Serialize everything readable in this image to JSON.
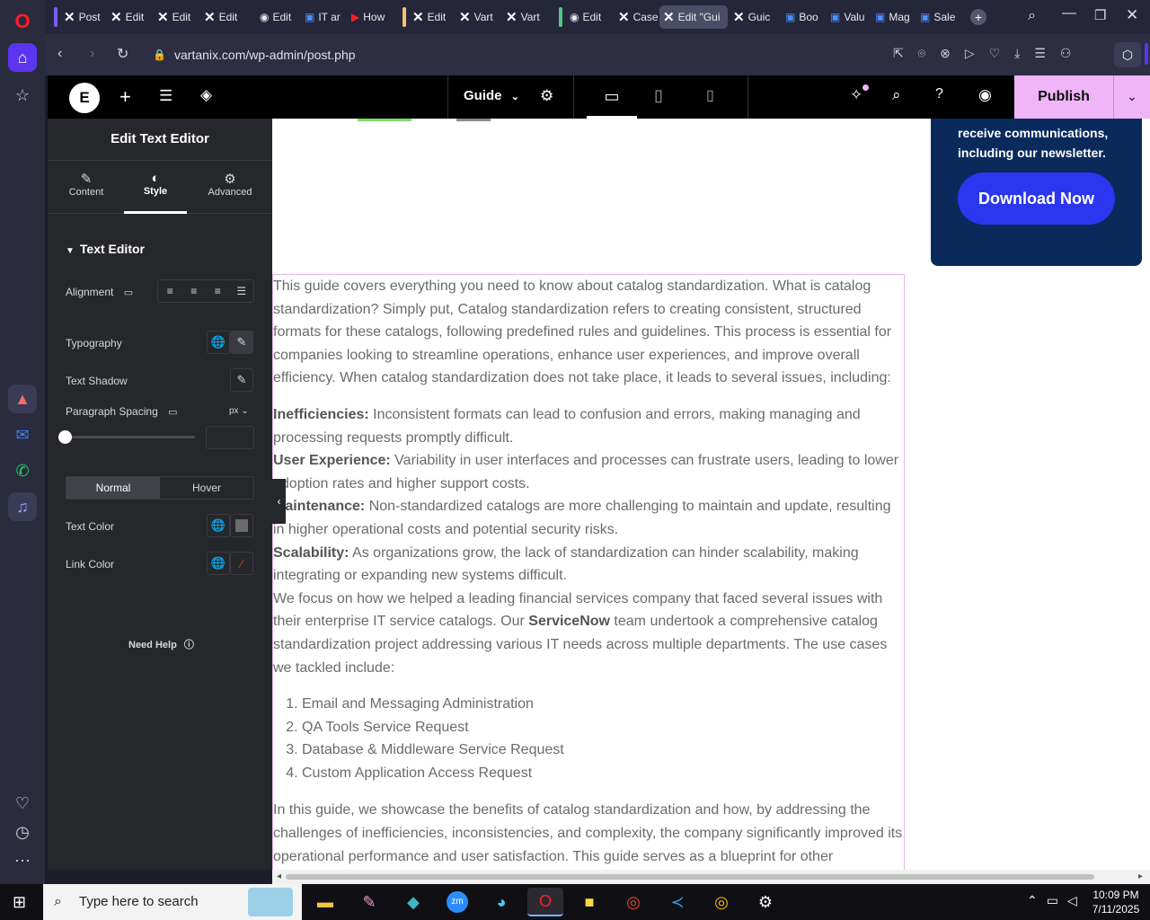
{
  "browser": {
    "tabs": [
      {
        "label": "Post",
        "icon": "elementor-icon"
      },
      {
        "label": "Edit",
        "icon": "elementor-icon"
      },
      {
        "label": "Edit",
        "icon": "elementor-icon"
      },
      {
        "label": "Edit",
        "icon": "elementor-icon"
      },
      {
        "label": "Edit",
        "icon": "wordpress-icon"
      },
      {
        "label": "IT ar",
        "icon": "doc-icon"
      },
      {
        "label": "How",
        "icon": "youtube-icon"
      },
      {
        "label": "Edit",
        "icon": "elementor-icon"
      },
      {
        "label": "Vart",
        "icon": "elementor-icon"
      },
      {
        "label": "Vart",
        "icon": "elementor-icon"
      },
      {
        "label": "Edit",
        "icon": "wordpress-icon"
      },
      {
        "label": "Case",
        "icon": "elementor-icon"
      },
      {
        "label": "Edit \"Gui",
        "icon": "elementor-icon"
      },
      {
        "label": "Guic",
        "icon": "elementor-icon"
      },
      {
        "label": "Boo",
        "icon": "doc-icon"
      },
      {
        "label": "Valu",
        "icon": "doc-icon"
      },
      {
        "label": "Mag",
        "icon": "doc-icon"
      },
      {
        "label": "Sale",
        "icon": "doc-icon"
      }
    ],
    "url": "vartanix.com/wp-admin/post.php"
  },
  "elementor_top": {
    "page_name": "Guide",
    "publish_label": "Publish"
  },
  "panel": {
    "title": "Edit Text Editor",
    "tabs": [
      {
        "label": "Content"
      },
      {
        "label": "Style"
      },
      {
        "label": "Advanced"
      }
    ],
    "section_title": "Text Editor",
    "alignment_label": "Alignment",
    "typography_label": "Typography",
    "text_shadow_label": "Text Shadow",
    "paragraph_spacing_label": "Paragraph Spacing",
    "paragraph_spacing_unit": "px",
    "state_normal": "Normal",
    "state_hover": "Hover",
    "text_color_label": "Text Color",
    "link_color_label": "Link Color",
    "need_help": "Need Help"
  },
  "canvas": {
    "promo_text_1": "receive communications,",
    "promo_text_2": "including our newsletter.",
    "promo_button": "Download Now",
    "intro": "This guide covers everything you need to know about catalog standardization. What is catalog standardization? Simply put, Catalog standardization refers to creating consistent, structured formats for these catalogs, following predefined rules and guidelines. This process is essential for companies looking to streamline operations, enhance user experiences, and improve overall efficiency. When catalog standardization does not take place, it leads to several issues, including:",
    "issues": [
      {
        "term": "Inefficiencies:",
        "text": " Inconsistent formats can lead to confusion and errors, making managing and processing requests promptly difficult."
      },
      {
        "term": "User Experience:",
        "text": " Variability in user interfaces and processes can frustrate users, leading to lower adoption rates and higher support costs."
      },
      {
        "term": "Maintenance:",
        "text": " Non-standardized catalogs are more challenging to maintain and update, resulting in higher operational costs and potential security risks."
      },
      {
        "term": "Scalability:",
        "text": " As organizations grow, the lack of standardization can hinder scalability, making integrating or expanding new systems difficult."
      }
    ],
    "focus_pre": "We focus on how we helped a leading financial services company that faced several issues with their enterprise IT service catalogs. Our ",
    "focus_bold": "ServiceNow",
    "focus_post": " team undertook a comprehensive catalog standardization project addressing various IT needs across multiple departments. The use cases we tackled include:",
    "use_cases": [
      "Email and Messaging Administration",
      "QA Tools Service Request",
      "Database & Middleware Service Request",
      "Custom Application Access Request"
    ],
    "closing": "In this guide, we showcase the benefits of catalog standardization and how, by addressing the challenges of inefficiencies, inconsistencies, and complexity, the company significantly improved its operational performance and user satisfaction. This guide serves as a blueprint for other"
  },
  "taskbar": {
    "search_placeholder": "Type here to search",
    "time": "10:09 PM",
    "date": "7/11/2025"
  },
  "colors": {
    "publish_bg": "#f0b5f7",
    "promo_button_bg": "#2b36f0",
    "accent_purple": "#9e1ff2"
  }
}
